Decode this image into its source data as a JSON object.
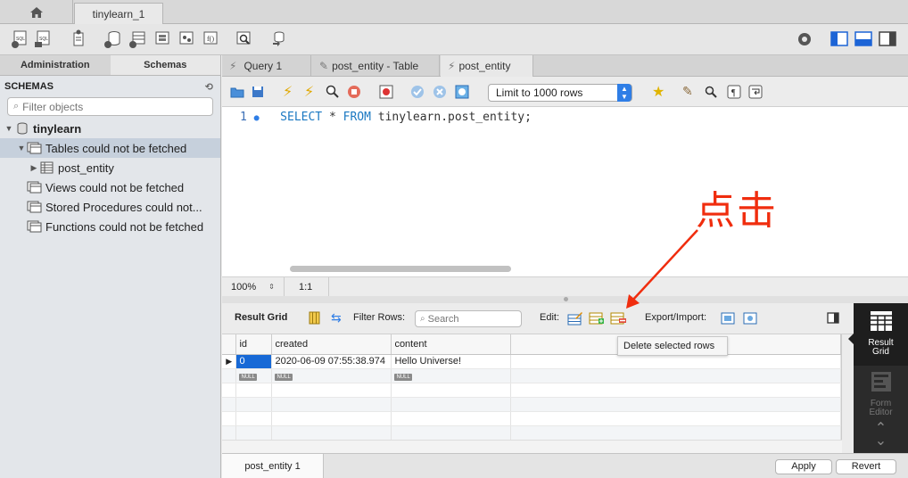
{
  "window": {
    "connection_tab": "tinylearn_1"
  },
  "left_panel": {
    "tabs": [
      "Administration",
      "Schemas"
    ],
    "header": "SCHEMAS",
    "filter_placeholder": "Filter objects",
    "tree": [
      {
        "label": "tinylearn"
      },
      {
        "label": "Tables could not be fetched"
      },
      {
        "label": "post_entity"
      },
      {
        "label": "Views could not be fetched"
      },
      {
        "label": "Stored Procedures could not..."
      },
      {
        "label": "Functions could not be fetched"
      }
    ]
  },
  "query_tabs": [
    "Query 1",
    "post_entity - Table",
    "post_entity"
  ],
  "editor_toolbar": {
    "limit_label": "Limit to 1000 rows"
  },
  "editor": {
    "line_number": "1",
    "kw_select": "SELECT",
    "star": "*",
    "kw_from": "FROM",
    "rest": "tinylearn.post_entity;"
  },
  "editor_status": {
    "zoom": "100%",
    "position": "1:1"
  },
  "result_toolbar": {
    "result_grid_label": "Result Grid",
    "filter_rows_label": "Filter Rows:",
    "search_placeholder": "Search",
    "edit_label": "Edit:",
    "export_label": "Export/Import:"
  },
  "grid": {
    "columns": [
      "id",
      "created",
      "content"
    ],
    "rows": [
      [
        "0",
        "2020-06-09 07:55:38.974",
        "Hello Universe!"
      ],
      [
        "NULL",
        "NULL",
        "NULL"
      ]
    ]
  },
  "tooltip": "Delete selected rows",
  "side_panel": {
    "result_grid": "Result\nGrid",
    "form_editor": "Form\nEditor"
  },
  "bottom": {
    "tab": "post_entity 1",
    "apply": "Apply",
    "revert": "Revert"
  },
  "annotation": {
    "text": "点击",
    "color": "#f02d0e"
  },
  "colors": {
    "accent": "#2f7ee6",
    "selection": "#1769d6",
    "sql_keyword": "#1a78c2"
  }
}
